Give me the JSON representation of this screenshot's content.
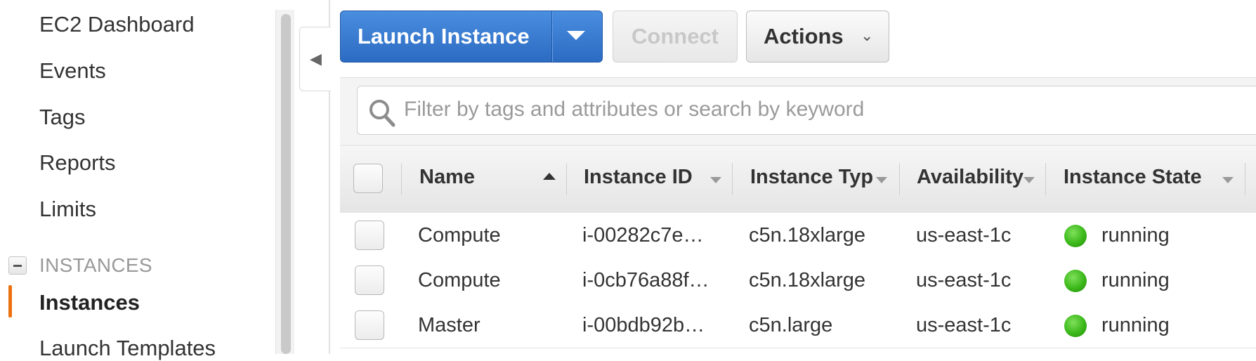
{
  "sidebar": {
    "items": [
      "EC2 Dashboard",
      "Events",
      "Tags",
      "Reports",
      "Limits"
    ],
    "section": "INSTANCES",
    "active_item": "Instances",
    "next_item": "Launch Templates"
  },
  "toolbar": {
    "launch_label": "Launch Instance",
    "connect_label": "Connect",
    "actions_label": "Actions"
  },
  "search": {
    "placeholder": "Filter by tags and attributes or search by keyword"
  },
  "table": {
    "columns": [
      "Name",
      "Instance ID",
      "Instance Typ",
      "Availability",
      "Instance State"
    ],
    "rows": [
      {
        "name": "Compute",
        "id": "i-00282c7e…",
        "type": "c5n.18xlarge",
        "az": "us-east-1c",
        "state": "running"
      },
      {
        "name": "Compute",
        "id": "i-0cb76a88f…",
        "type": "c5n.18xlarge",
        "az": "us-east-1c",
        "state": "running"
      },
      {
        "name": "Master",
        "id": "i-00bdb92b…",
        "type": "c5n.large",
        "az": "us-east-1c",
        "state": "running"
      }
    ]
  },
  "colors": {
    "primary_button": "#2c6bc2",
    "active_accent": "#ec7211",
    "running_status": "#3bb81a"
  }
}
